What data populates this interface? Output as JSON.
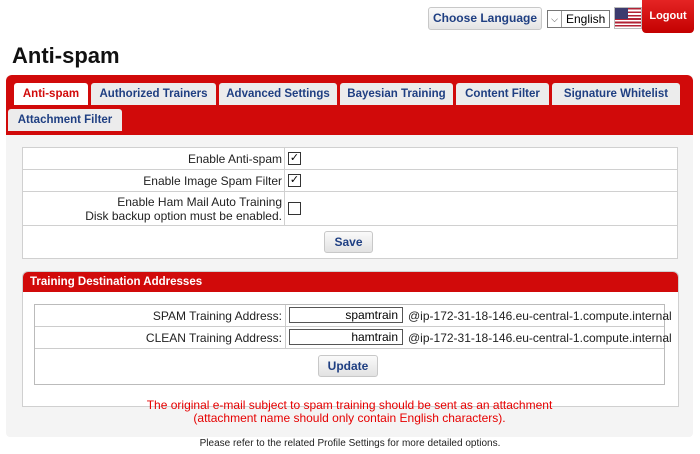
{
  "header": {
    "choose_language_label": "Choose Language",
    "language_value": "English",
    "logout_label": "Logout"
  },
  "page": {
    "title": "Anti-spam"
  },
  "tabs": [
    {
      "label": "Anti-spam",
      "active": true
    },
    {
      "label": "Authorized Trainers"
    },
    {
      "label": "Advanced Settings"
    },
    {
      "label": "Bayesian Training"
    },
    {
      "label": "Content Filter"
    },
    {
      "label": "Signature Whitelist"
    },
    {
      "label": "Attachment Filter"
    }
  ],
  "settings": {
    "enable_antispam": {
      "label": "Enable Anti-spam",
      "checked": true
    },
    "enable_image_spam": {
      "label": "Enable Image Spam Filter",
      "checked": true
    },
    "enable_ham_auto": {
      "label": "Enable Ham Mail Auto Training",
      "note": "Disk backup option must be enabled.",
      "checked": false
    },
    "save_label": "Save"
  },
  "training": {
    "header": "Training Destination Addresses",
    "spam_label": "SPAM Training Address:",
    "spam_value": "spamtrain",
    "clean_label": "CLEAN Training Address:",
    "clean_value": "hamtrain",
    "domain": "@ip-172-31-18-146.eu-central-1.compute.internal",
    "update_label": "Update"
  },
  "notes": {
    "attachment_line1": "The original e-mail subject to spam training should be sent as an attachment",
    "attachment_line2": "(attachment name should only contain English characters).",
    "footer": "Please refer to the related Profile Settings for more detailed options."
  },
  "colors": {
    "accent": "#d10a0a",
    "link": "#1f3f82",
    "warning": "#e60000"
  }
}
